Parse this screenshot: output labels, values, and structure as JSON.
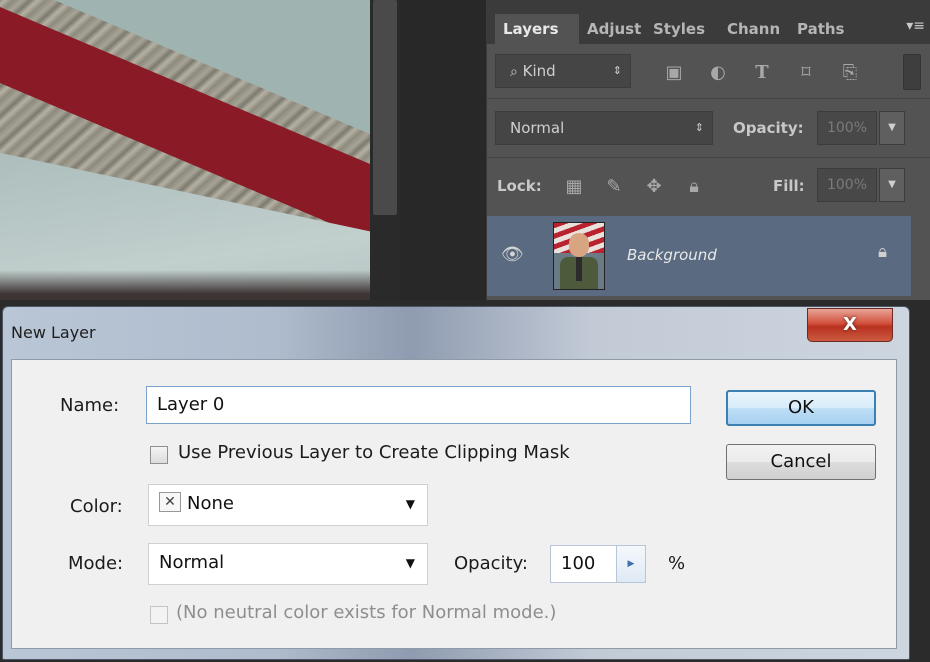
{
  "layers_panel": {
    "tabs": [
      "Layers",
      "Adjust",
      "Styles",
      "Chann",
      "Paths"
    ],
    "filter_kind": "Kind",
    "blend_mode": "Normal",
    "opacity_label": "Opacity:",
    "opacity_value": "100%",
    "lock_label": "Lock:",
    "fill_label": "Fill:",
    "fill_value": "100%",
    "layer": {
      "name": "Background",
      "visible": true,
      "locked": true
    }
  },
  "dialog": {
    "title": "New Layer",
    "close_label": "X",
    "name_label": "Name:",
    "name_value": "Layer 0",
    "clip_label": "Use Previous Layer to Create Clipping Mask",
    "clip_checked": false,
    "color_label": "Color:",
    "color_value": "None",
    "mode_label": "Mode:",
    "mode_value": "Normal",
    "opacity_label": "Opacity:",
    "opacity_value": "100",
    "opacity_unit": "%",
    "neutral_label": "(No neutral color exists for Normal mode.)",
    "neutral_checked": false,
    "ok_label": "OK",
    "cancel_label": "Cancel"
  },
  "colors": {
    "panel_bg": "#535353",
    "selected_layer": "#5a6a80",
    "dialog_bg": "#f0f0f0",
    "close_red": "#c8432f",
    "default_button_border": "#3c7fb1"
  }
}
